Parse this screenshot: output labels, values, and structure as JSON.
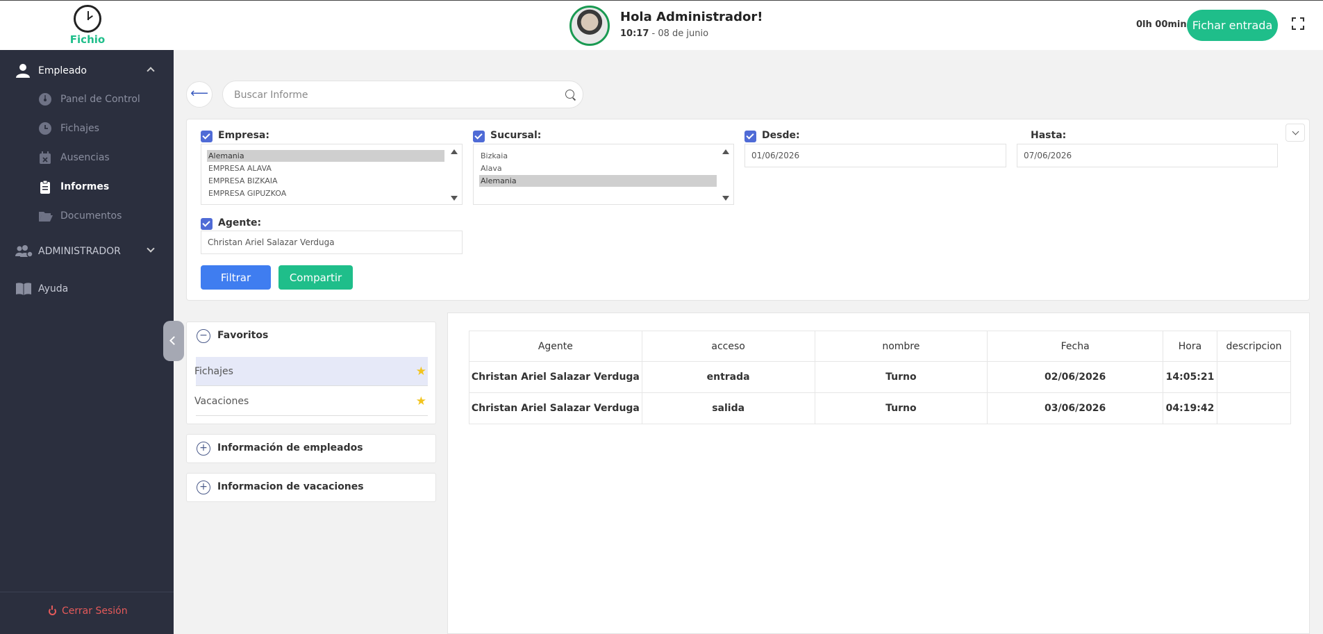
{
  "header": {
    "logo_text": "Fichio",
    "greeting": "Hola Administrador!",
    "time": "10:17",
    "date_sep": " - ",
    "date": "08 de junio",
    "timer": "0lh 00min",
    "clock_in_label": "Fichar entrada"
  },
  "sidebar": {
    "sections": [
      {
        "label": "Empleado",
        "icon": "user-icon",
        "expanded": true
      },
      {
        "label": "ADMINISTRADOR",
        "icon": "users-cog-icon",
        "expanded": false
      },
      {
        "label": "Ayuda",
        "icon": "book-icon"
      }
    ],
    "items": [
      {
        "label": "Panel de Control",
        "icon": "dashboard-icon"
      },
      {
        "label": "Fichajes",
        "icon": "clock-icon"
      },
      {
        "label": "Ausencias",
        "icon": "calendar-x-icon"
      },
      {
        "label": "Informes",
        "icon": "clipboard-icon",
        "active": true
      },
      {
        "label": "Documentos",
        "icon": "folder-open-icon"
      }
    ],
    "logout_label": "Cerrar Sesión"
  },
  "search": {
    "placeholder": "Buscar Informe"
  },
  "filters": {
    "empresa": {
      "label": "Empresa:",
      "options": [
        "Alemania",
        "EMPRESA ALAVA",
        "EMPRESA BIZKAIA",
        "EMPRESA GIPUZKOA"
      ],
      "selected": "Alemania"
    },
    "sucursal": {
      "label": "Sucursal:",
      "options": [
        "Bizkaia",
        "Alava",
        "Alemania"
      ],
      "selected": "Alemania"
    },
    "desde": {
      "label": "Desde:",
      "value": "01/06/2026"
    },
    "hasta": {
      "label": "Hasta:",
      "value": "07/06/2026"
    },
    "agente": {
      "label": "Agente:",
      "value": "Christan Ariel Salazar Verduga"
    },
    "filter_button": "Filtrar",
    "share_button": "Compartir"
  },
  "favorites": {
    "title": "Favoritos",
    "items": [
      {
        "label": "Fichajes",
        "active": true
      },
      {
        "label": "Vacaciones",
        "active": false
      }
    ]
  },
  "accordions": [
    {
      "label": "Información de empleados"
    },
    {
      "label": "Informacion de vacaciones"
    }
  ],
  "table": {
    "columns": [
      "Agente",
      "acceso",
      "nombre",
      "Fecha",
      "Hora",
      "descripcion"
    ],
    "rows": [
      [
        "Christan Ariel Salazar Verduga",
        "entrada",
        "Turno",
        "02/06/2026",
        "14:05:21",
        ""
      ],
      [
        "Christan Ariel Salazar Verduga",
        "salida",
        "Turno",
        "03/06/2026",
        "04:19:42",
        ""
      ]
    ]
  },
  "colors": {
    "brand_green": "#1fbe8a",
    "primary_blue": "#3f7df0",
    "sidebar_bg": "#2b2f3e",
    "logout_red": "#e55a5a",
    "star_yellow": "#f2c41e"
  }
}
